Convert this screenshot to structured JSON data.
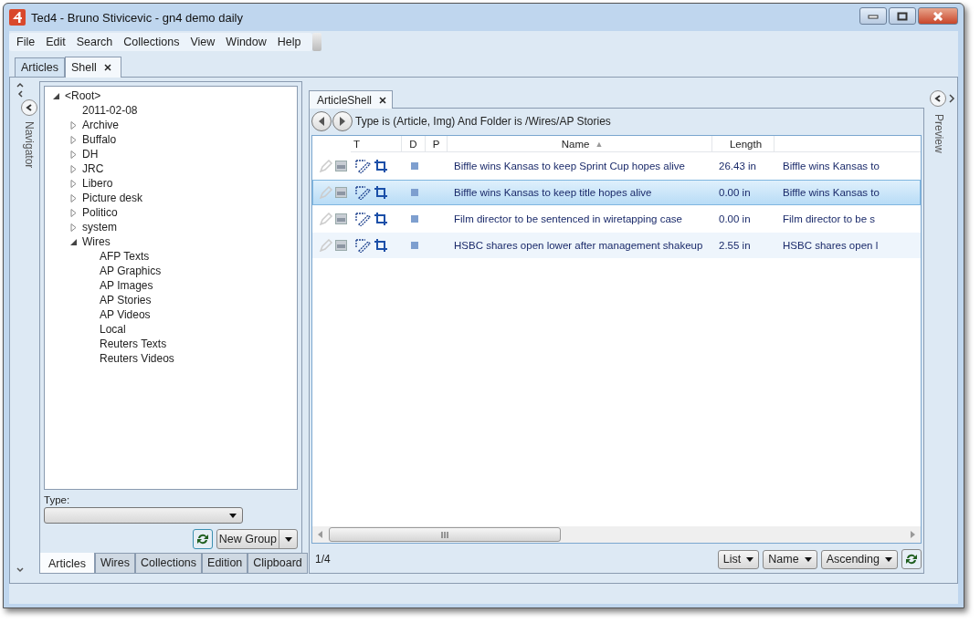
{
  "window": {
    "title": "Ted4 - Bruno Stivicevic - gn4 demo daily"
  },
  "menu": [
    "File",
    "Edit",
    "Search",
    "Collections",
    "View",
    "Window",
    "Help"
  ],
  "tabs": [
    {
      "label": "Articles",
      "selected": false,
      "closable": false
    },
    {
      "label": "Shell",
      "selected": true,
      "closable": true
    }
  ],
  "navigator": {
    "label": "Navigator"
  },
  "tree": [
    {
      "label": "<Root>",
      "kind": "folder",
      "expanded": true,
      "children": [
        {
          "label": "2011-02-08",
          "kind": "leaf"
        },
        {
          "label": "Archive",
          "kind": "folder",
          "expanded": false
        },
        {
          "label": "Buffalo",
          "kind": "folder",
          "expanded": false
        },
        {
          "label": "DH",
          "kind": "folder",
          "expanded": false
        },
        {
          "label": "JRC",
          "kind": "folder",
          "expanded": false
        },
        {
          "label": "Libero",
          "kind": "folder",
          "expanded": false
        },
        {
          "label": "Picture desk",
          "kind": "folder",
          "expanded": false
        },
        {
          "label": "Politico",
          "kind": "folder",
          "expanded": false
        },
        {
          "label": "system",
          "kind": "folder",
          "expanded": false
        },
        {
          "label": "Wires",
          "kind": "folder",
          "expanded": true,
          "children": [
            {
              "label": "AFP Texts",
              "kind": "leaf"
            },
            {
              "label": "AP Graphics",
              "kind": "leaf"
            },
            {
              "label": "AP Images",
              "kind": "leaf"
            },
            {
              "label": "AP Stories",
              "kind": "leaf"
            },
            {
              "label": "AP Videos",
              "kind": "leaf"
            },
            {
              "label": "Local",
              "kind": "leaf"
            },
            {
              "label": "Reuters Texts",
              "kind": "leaf"
            },
            {
              "label": "Reuters Videos",
              "kind": "leaf"
            }
          ]
        }
      ]
    }
  ],
  "type_field": {
    "label": "Type:"
  },
  "new_group_button": {
    "label": "New Group"
  },
  "nav_tabs": [
    {
      "label": "Articles",
      "selected": true
    },
    {
      "label": "Wires",
      "selected": false
    },
    {
      "label": "Collections",
      "selected": false
    },
    {
      "label": "Edition",
      "selected": false
    },
    {
      "label": "Clipboard",
      "selected": false
    }
  ],
  "shell_tab": {
    "label": "ArticleShell",
    "closable": true
  },
  "query": "Type is (Article, Img) And Folder is /Wires/AP Stories",
  "table": {
    "columns": [
      {
        "label": "T"
      },
      {
        "label": "D"
      },
      {
        "label": "P"
      },
      {
        "label": "Name",
        "sort_arrow": "▲"
      },
      {
        "label": "Length"
      }
    ],
    "rows": [
      {
        "name": "Biffle wins Kansas to keep Sprint Cup hopes alive",
        "length": "26.43 in",
        "column_6": "Biffle wins Kansas to",
        "selected": false
      },
      {
        "name": "Biffle wins Kansas to keep title hopes alive",
        "length": "0.00 in",
        "column_6": "Biffle wins Kansas to",
        "selected": true
      },
      {
        "name": "Film director to be sentenced in wiretapping case",
        "length": "0.00 in",
        "column_6": "Film director to be s",
        "selected": false
      },
      {
        "name": "HSBC shares open lower after management shakeup",
        "length": "2.55 in",
        "column_6": "HSBC shares open l",
        "selected": false
      }
    ]
  },
  "count": "1/4",
  "view_dropdowns": [
    "List",
    "Name",
    "Ascending"
  ],
  "preview": {
    "label": "Preview"
  }
}
